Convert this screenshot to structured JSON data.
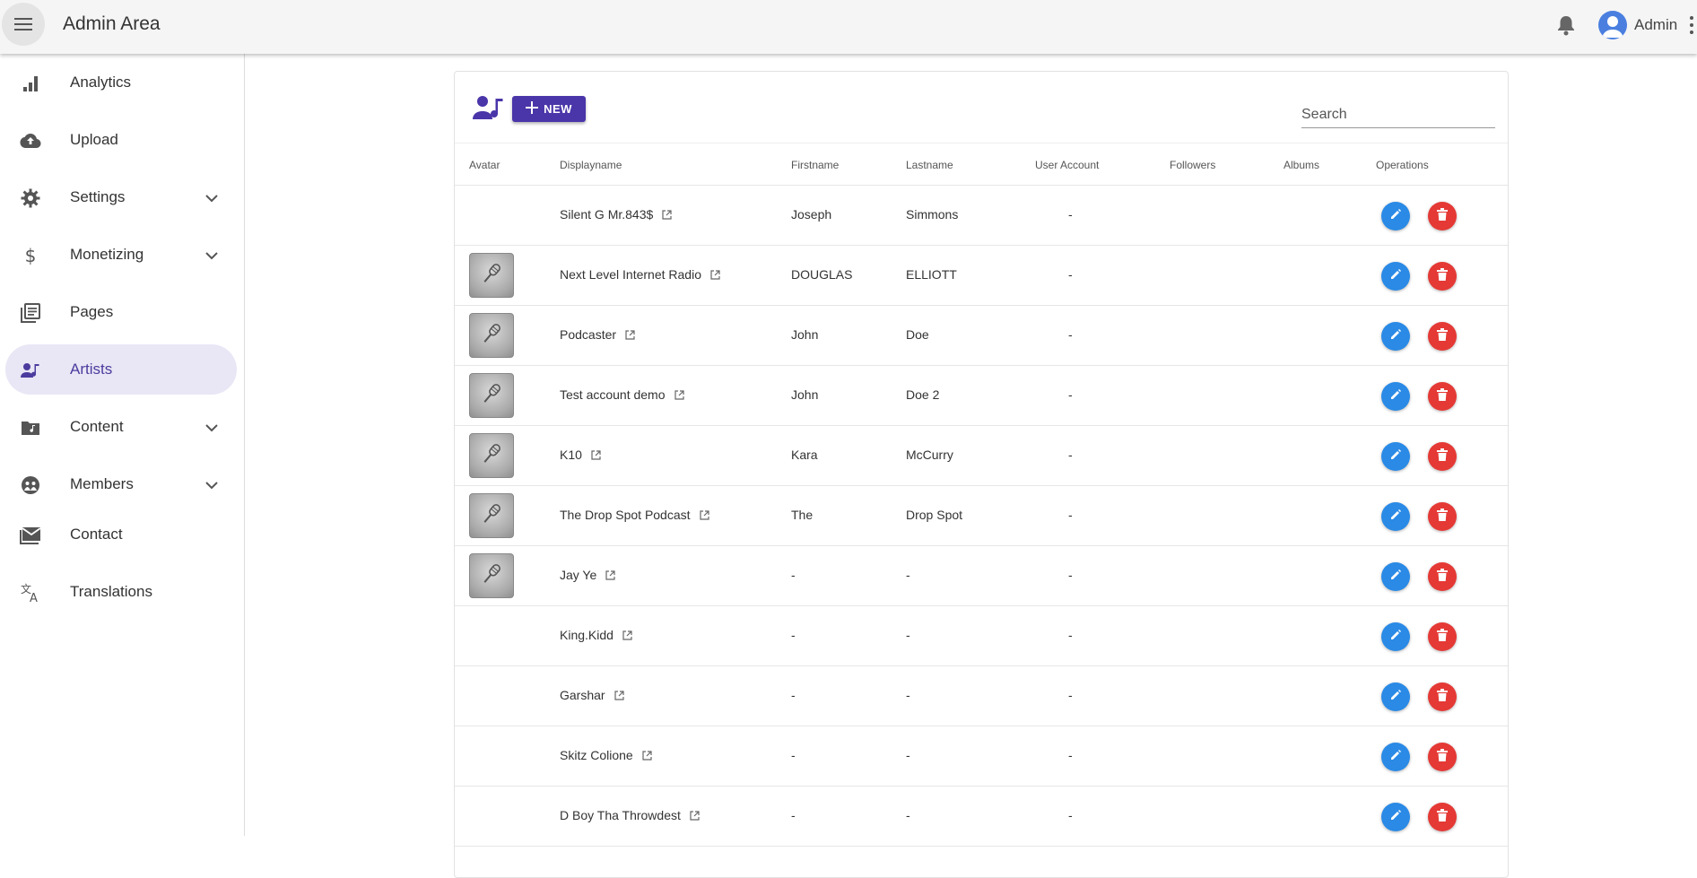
{
  "app": {
    "title": "Admin Area",
    "user_name": "Admin"
  },
  "sidebar": {
    "items": [
      {
        "label": "Analytics",
        "icon": "bar-chart-icon",
        "expandable": false,
        "active": false
      },
      {
        "label": "Upload",
        "icon": "cloud-upload-icon",
        "expandable": false,
        "active": false
      },
      {
        "label": "Settings",
        "icon": "gear-icon",
        "expandable": true,
        "active": false
      },
      {
        "label": "Monetizing",
        "icon": "dollar-icon",
        "expandable": true,
        "active": false
      },
      {
        "label": "Pages",
        "icon": "pages-icon",
        "expandable": false,
        "active": false
      },
      {
        "label": "Artists",
        "icon": "artist-icon",
        "expandable": false,
        "active": true
      },
      {
        "label": "Content",
        "icon": "music-folder-icon",
        "expandable": true,
        "active": false
      },
      {
        "label": "Members",
        "icon": "members-icon",
        "expandable": true,
        "active": false
      },
      {
        "label": "Contact",
        "icon": "mail-icon",
        "expandable": false,
        "active": false
      },
      {
        "label": "Translations",
        "icon": "translate-icon",
        "expandable": false,
        "active": false
      }
    ]
  },
  "toolbar": {
    "new_label": "NEW",
    "search_placeholder": "Search"
  },
  "table": {
    "headers": {
      "avatar": "Avatar",
      "displayname": "Displayname",
      "firstname": "Firstname",
      "lastname": "Lastname",
      "user_account": "User Account",
      "followers": "Followers",
      "albums": "Albums",
      "operations": "Operations"
    },
    "rows": [
      {
        "has_avatar": false,
        "displayname": "Silent G Mr.843$",
        "firstname": "Joseph",
        "lastname": "Simmons",
        "user_account": "-"
      },
      {
        "has_avatar": true,
        "displayname": "Next Level Internet Radio",
        "firstname": "DOUGLAS",
        "lastname": "ELLIOTT",
        "user_account": "-"
      },
      {
        "has_avatar": true,
        "displayname": "Podcaster",
        "firstname": "John",
        "lastname": "Doe",
        "user_account": "-"
      },
      {
        "has_avatar": true,
        "displayname": "Test account demo",
        "firstname": "John",
        "lastname": "Doe 2",
        "user_account": "-"
      },
      {
        "has_avatar": true,
        "displayname": "K10",
        "firstname": "Kara",
        "lastname": "McCurry",
        "user_account": "-"
      },
      {
        "has_avatar": true,
        "displayname": "The Drop Spot Podcast",
        "firstname": "The",
        "lastname": "Drop Spot",
        "user_account": "-"
      },
      {
        "has_avatar": true,
        "displayname": "Jay Ye",
        "firstname": "-",
        "lastname": "-",
        "user_account": "-"
      },
      {
        "has_avatar": false,
        "displayname": "King.Kidd",
        "firstname": "-",
        "lastname": "-",
        "user_account": "-"
      },
      {
        "has_avatar": false,
        "displayname": "Garshar",
        "firstname": "-",
        "lastname": "-",
        "user_account": "-"
      },
      {
        "has_avatar": false,
        "displayname": "Skitz Colione",
        "firstname": "-",
        "lastname": "-",
        "user_account": "-"
      },
      {
        "has_avatar": false,
        "displayname": "D Boy Tha Throwdest",
        "firstname": "-",
        "lastname": "-",
        "user_account": "-"
      }
    ]
  },
  "colors": {
    "accent": "#4a35a9",
    "active_bg": "#e9e6f5",
    "edit": "#2a8ae6",
    "delete": "#e53935"
  }
}
